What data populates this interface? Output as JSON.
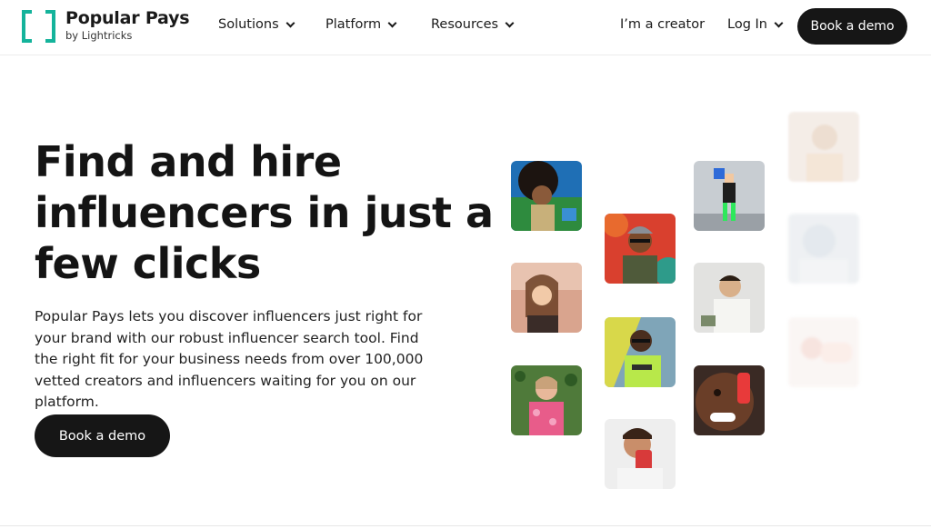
{
  "brand": {
    "name": "Popular Pays",
    "tagline": "by Lightricks",
    "accent_color": "#14b39b"
  },
  "nav": {
    "items": [
      {
        "label": "Solutions",
        "icon": "chevron-down-icon"
      },
      {
        "label": "Platform",
        "icon": "chevron-down-icon"
      },
      {
        "label": "Resources",
        "icon": "chevron-down-icon"
      }
    ],
    "creator_link": "I’m a creator",
    "login": {
      "label": "Log In",
      "icon": "chevron-down-icon"
    },
    "cta": "Book a demo"
  },
  "hero": {
    "title_lines": [
      "Find and hire",
      "influencers in just a",
      "few clicks"
    ],
    "description": "Popular Pays lets you discover influencers just right for your brand with our robust influencer search tool. Find the right fit for your business needs from over 100,000 vetted creators and influencers waiting for you on our platform.",
    "cta": "Book a demo"
  },
  "gallery": {
    "tiles": [
      "creator-photo-afro-woman",
      "creator-photo-beanie-man",
      "creator-photo-flowers-woman",
      "creator-photo-hair-woman",
      "creator-photo-sunglasses-man",
      "creator-photo-seated-man",
      "creator-photo-pink-shirt-man",
      "creator-photo-drinking-man",
      "creator-photo-lipstick-woman",
      "creator-photo-faded-1",
      "creator-photo-faded-2",
      "creator-photo-faded-3"
    ]
  }
}
